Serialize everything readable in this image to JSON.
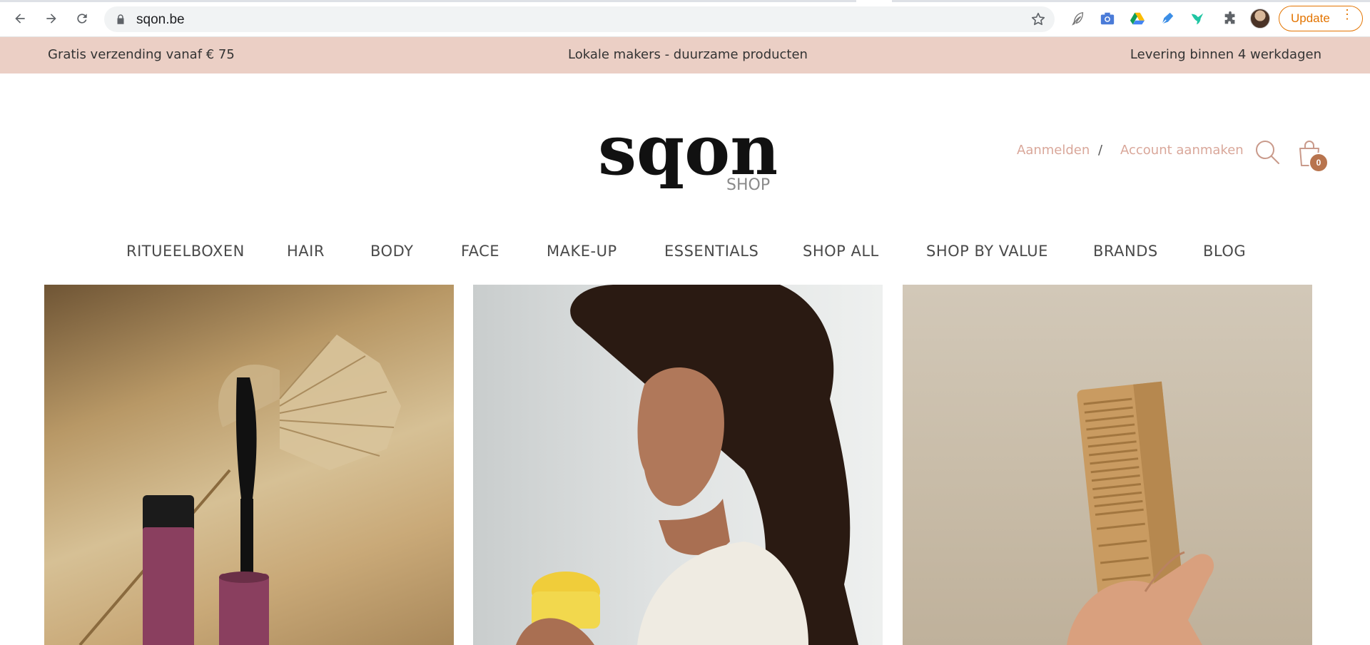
{
  "browser": {
    "url": "sqon.be",
    "update_label": "Update",
    "extensions": [
      "feather-icon",
      "camera-icon",
      "google-drive-icon",
      "pen-nib-icon",
      "hummingbird-icon",
      "puzzle-icon"
    ]
  },
  "announcement": {
    "left": "Gratis verzending vanaf € 75",
    "center": "Lokale makers - duurzame producten",
    "right": "Levering binnen 4 werkdagen"
  },
  "header": {
    "logo_text": "sqon",
    "logo_sub": "SHOP",
    "login_label": "Aanmelden",
    "separator": "/",
    "register_label": "Account aanmaken",
    "cart_count": "0",
    "accent_color": "#d9a79a",
    "badge_color": "#b8744e"
  },
  "nav": {
    "items": [
      {
        "label": "RITUEELBOXEN"
      },
      {
        "label": "HAIR"
      },
      {
        "label": "BODY"
      },
      {
        "label": "FACE"
      },
      {
        "label": "MAKE-UP"
      },
      {
        "label": "ESSENTIALS"
      },
      {
        "label": "SHOP ALL"
      },
      {
        "label": "SHOP BY VALUE"
      },
      {
        "label": "BRANDS"
      },
      {
        "label": "BLOG"
      }
    ]
  },
  "tiles": [
    {
      "subject": "mascara-with-palm-leaf"
    },
    {
      "subject": "woman-with-body-butter-jar"
    },
    {
      "subject": "hand-holding-wooden-comb"
    }
  ]
}
